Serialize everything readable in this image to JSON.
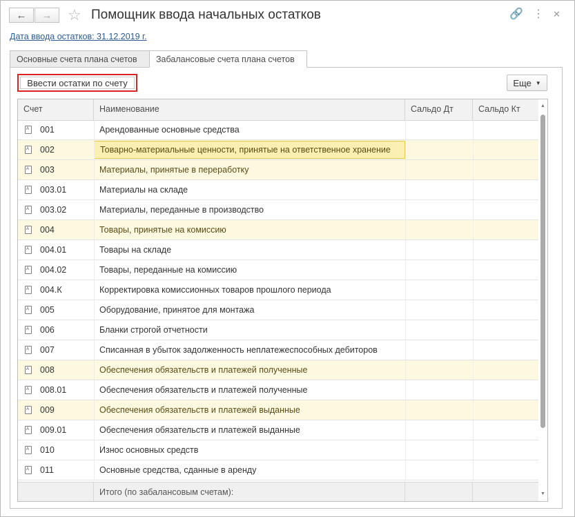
{
  "window": {
    "title": "Помощник ввода начальных остатков",
    "back_icon": "←",
    "forward_icon": "→",
    "star_icon": "☆",
    "link_icon": "🔗",
    "more_icon": "⋮",
    "close_icon": "✕"
  },
  "date_link": "Дата ввода остатков: 31.12.2019 г.",
  "tabs": [
    {
      "label": "Основные счета плана счетов",
      "active": false
    },
    {
      "label": "Забалансовые счета плана счетов",
      "active": true
    }
  ],
  "toolbar": {
    "enter_button": "Ввести остатки по счету",
    "more_button": "Еще",
    "more_arrow": "▼"
  },
  "table": {
    "columns": [
      "Счет",
      "Наименование",
      "Сальдо Дт",
      "Сальдо Кт"
    ],
    "rows": [
      {
        "code": "001",
        "name": "Арендованные основные средства",
        "highlight": false
      },
      {
        "code": "002",
        "name": "Товарно-материальные ценности, принятые на ответственное хранение",
        "highlight": true,
        "selected": true
      },
      {
        "code": "003",
        "name": "Материалы, принятые в переработку",
        "highlight": true
      },
      {
        "code": "003.01",
        "name": "Материалы на складе",
        "highlight": false
      },
      {
        "code": "003.02",
        "name": "Материалы, переданные в производство",
        "highlight": false
      },
      {
        "code": "004",
        "name": "Товары, принятые на комиссию",
        "highlight": true
      },
      {
        "code": "004.01",
        "name": "Товары на складе",
        "highlight": false
      },
      {
        "code": "004.02",
        "name": "Товары, переданные на комиссию",
        "highlight": false
      },
      {
        "code": "004.К",
        "name": "Корректировка комиссионных товаров прошлого периода",
        "highlight": false
      },
      {
        "code": "005",
        "name": "Оборудование, принятое для монтажа",
        "highlight": false
      },
      {
        "code": "006",
        "name": "Бланки строгой отчетности",
        "highlight": false
      },
      {
        "code": "007",
        "name": "Списанная в убыток задолженность неплатежеспособных дебиторов",
        "highlight": false
      },
      {
        "code": "008",
        "name": "Обеспечения обязательств и платежей полученные",
        "highlight": true
      },
      {
        "code": "008.01",
        "name": "Обеспечения обязательств и платежей полученные",
        "highlight": false
      },
      {
        "code": "009",
        "name": "Обеспечения обязательств и платежей выданные",
        "highlight": true
      },
      {
        "code": "009.01",
        "name": "Обеспечения обязательств и платежей выданные",
        "highlight": false
      },
      {
        "code": "010",
        "name": "Износ основных средств",
        "highlight": false
      },
      {
        "code": "011",
        "name": "Основные средства, сданные в аренду",
        "highlight": false
      }
    ],
    "footer_label": "Итого (по забалансовым счетам):"
  },
  "colors": {
    "highlight_row": "#fdf9e1",
    "selected_cell": "#fbf0b2",
    "annotation_border": "#d9251f",
    "link": "#2d5b97"
  }
}
